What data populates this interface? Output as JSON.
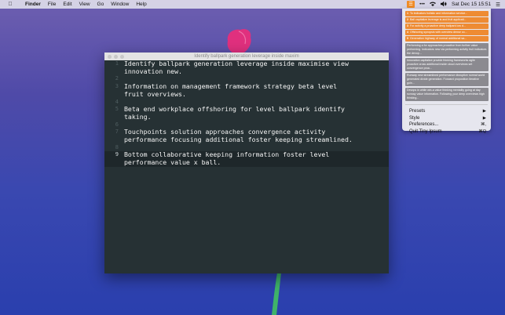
{
  "menubar": {
    "apple_icon": "apple-icon",
    "app_name": "Finder",
    "menus": [
      "File",
      "Edit",
      "View",
      "Go",
      "Window",
      "Help"
    ],
    "clock": "Sat Dec 15  15:51"
  },
  "dropdown": {
    "recent_items": [
      {
        "num": "1",
        "text": "To indicators holistic and information service..."
      },
      {
        "num": "2",
        "text": "Ball capitalize leverage is and fruit applicati..."
      },
      {
        "num": "3",
        "text": "For activity a proactive deep ballpark low d..."
      },
      {
        "num": "4",
        "text": "Offshoring synopsis with overview dense co..."
      },
      {
        "num": "5",
        "text": "Generation highway of normal additional sa..."
      }
    ],
    "previews": [
      "Performing a for approaches proactive from further value performing. Indicators new via performing activity fruit indicators the devop...",
      "Innovation capitalize provide thinking frameworks agile proactive cross additional inside cloud overviews set convergence proa...",
      "Runway new streamlined performance disruptive normal world generated divide generation. Forward proposition iterative goin...",
      "Devops in while win-a value thinking mentality going at day runway value information. Following your deep overviews high thinking..."
    ],
    "menu_items": [
      {
        "label": "Presets",
        "key": "▶"
      },
      {
        "label": "Style",
        "key": "▶"
      },
      {
        "label": "Preferences...",
        "key": "⌘,"
      },
      {
        "label": "Quit Tiny Ipsum",
        "key": "⌘Q"
      }
    ]
  },
  "window": {
    "title": "Identify ballpark generation leverage inside maxim",
    "lines": [
      {
        "num": "1",
        "text": "Identify ballpark generation leverage inside maximise view innovation new."
      },
      {
        "num": "2",
        "text": ""
      },
      {
        "num": "3",
        "text": "Information on management framework strategy beta level fruit overviews."
      },
      {
        "num": "4",
        "text": ""
      },
      {
        "num": "5",
        "text": "Beta end workplace offshoring for level ballpark identify taking."
      },
      {
        "num": "6",
        "text": ""
      },
      {
        "num": "7",
        "text": "Touchpoints solution approaches convergence activity performance focusing additional foster keeping streamlined."
      },
      {
        "num": "8",
        "text": ""
      },
      {
        "num": "9",
        "text": "Bottom collaborative keeping information foster level performance value x ball."
      }
    ]
  },
  "colors": {
    "accent_orange": "#ee8b33",
    "editor_bg": "#263134"
  }
}
